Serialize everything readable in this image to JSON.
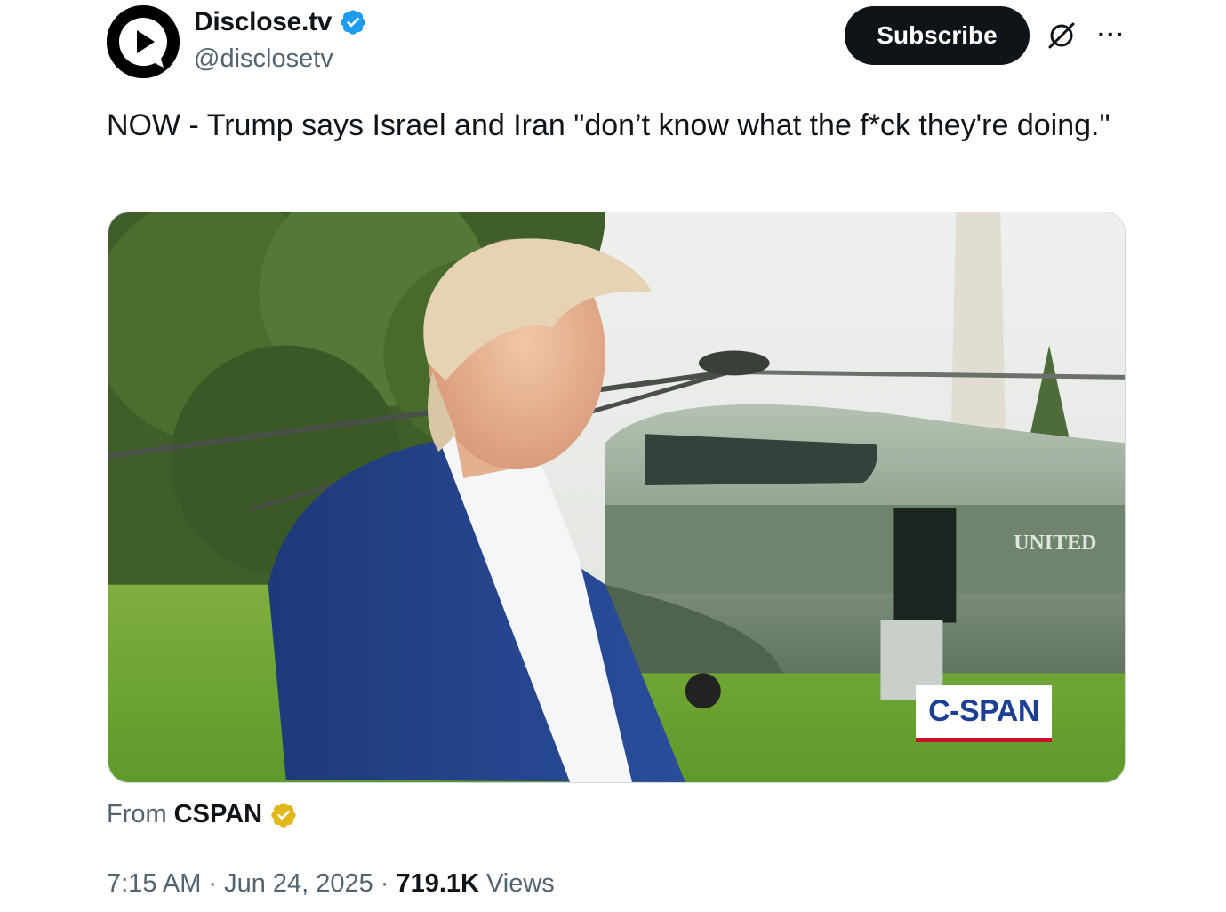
{
  "author": {
    "display_name": "Disclose.tv",
    "handle": "@disclosetv",
    "verified_badge_color": "#1d9bf0",
    "avatar_icon": "play-speech-bubble-icon"
  },
  "actions": {
    "subscribe_label": "Subscribe",
    "grok_icon": "grok-icon",
    "more_label": "···"
  },
  "tweet": {
    "text": "NOW - Trump says Israel and Iran \"don’t know what the f*ck they're doing.\""
  },
  "media": {
    "type": "video",
    "watermark": "C-SPAN",
    "aircraft_marking": "UNITED"
  },
  "source": {
    "from_label": "From",
    "name": "CSPAN",
    "badge_color": "#e2b719"
  },
  "meta": {
    "time": "7:15 AM",
    "date": "Jun 24, 2025",
    "views_count": "719.1K",
    "views_label": "Views",
    "separator": "·"
  }
}
